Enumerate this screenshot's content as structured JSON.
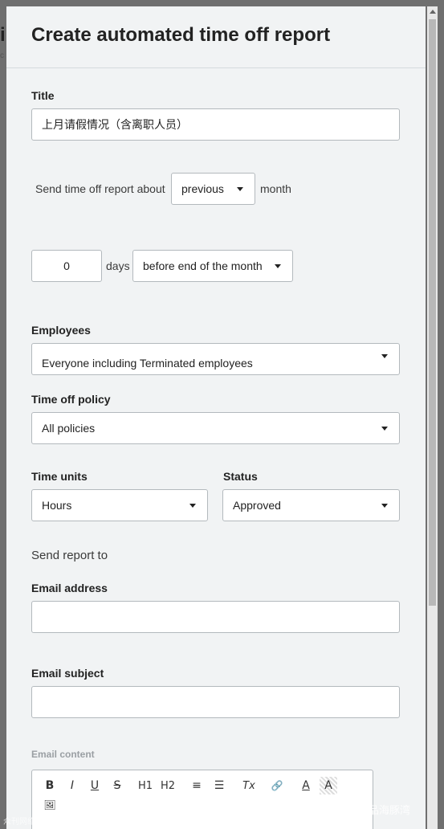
{
  "background_peek": {
    "char": "i",
    "sub": "c"
  },
  "modal": {
    "title": "Create automated time off report"
  },
  "title_field": {
    "label": "Title",
    "value": "上月请假情况（含离职人员）"
  },
  "period": {
    "prefix": "Send time off report about",
    "selected": "previous",
    "suffix": "month"
  },
  "schedule": {
    "days_value": "0",
    "days_label": "days",
    "when_selected": "before end of the month"
  },
  "employees": {
    "label": "Employees",
    "selected": "Everyone including Terminated employees"
  },
  "policy": {
    "label": "Time off policy",
    "selected": "All policies"
  },
  "time_units": {
    "label": "Time units",
    "selected": "Hours"
  },
  "status": {
    "label": "Status",
    "selected": "Approved"
  },
  "send_to": {
    "heading": "Send report to"
  },
  "email_address": {
    "label": "Email address",
    "value": ""
  },
  "email_subject": {
    "label": "Email subject",
    "value": ""
  },
  "email_content": {
    "label": "Email content",
    "toolbar": {
      "bold": "B",
      "italic": "I",
      "underline": "U",
      "strike": "S",
      "h1": "H1",
      "h2": "H2",
      "ordered_list": "≡",
      "bullet_list": "☰",
      "clear_format": "Tx",
      "link": "🔗",
      "text_color": "A",
      "bg_color": "A",
      "image": "🖼"
    }
  },
  "watermarks": {
    "right": "产品海豚湾",
    "left": "众刊网络"
  },
  "colors": {
    "modal_bg": "#f1f3f4",
    "overlay": "#6f6f6f",
    "border": "#b3b9bd"
  }
}
